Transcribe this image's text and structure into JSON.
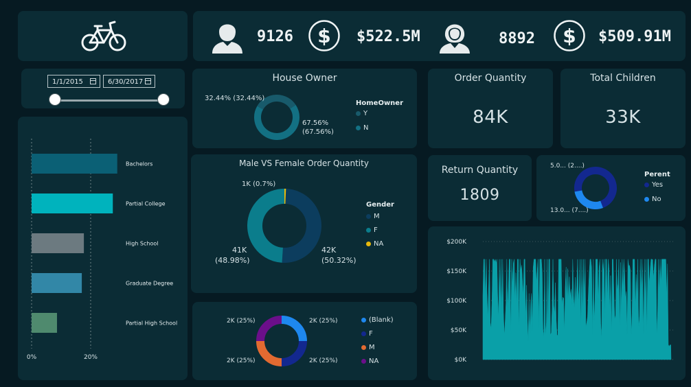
{
  "kpis": {
    "male_count": "9126",
    "male_revenue": "$522.5M",
    "female_count": "8892",
    "female_revenue": "$509.91M"
  },
  "date_filter": {
    "start": "1/1/2015",
    "end": "6/30/2017",
    "range_fraction": [
      0,
      1
    ]
  },
  "education_chart": {
    "type": "bar",
    "orientation": "horizontal",
    "categories": [
      "Bachelors",
      "Partial College",
      "High School",
      "Graduate Degree",
      "Partial High School"
    ],
    "values": [
      29,
      27.5,
      17.7,
      17,
      8.6
    ],
    "colors": [
      "#0b6075",
      "#00b3bd",
      "#6c7a80",
      "#3287a7",
      "#4f8a6e"
    ],
    "xlim": [
      0,
      30
    ],
    "x_ticks": [
      "0%",
      "20%"
    ],
    "x_tick_values": [
      0,
      20
    ],
    "grid": true
  },
  "house_owner": {
    "title": "House Owner",
    "legend_title": "HomeOwner",
    "chart_data": {
      "type": "pie",
      "categories": [
        "Y",
        "N"
      ],
      "values": [
        32.44,
        67.56
      ],
      "colors": [
        "#185a6b",
        "#137083"
      ]
    },
    "slice_labels": [
      "32.44% (32.44%)",
      "67.56%",
      "(67.56%)"
    ]
  },
  "order_quantity": {
    "title": "Order Quantity",
    "value": "84K"
  },
  "total_children": {
    "title": "Total Children",
    "value": "33K"
  },
  "gender_orders": {
    "title": "Male VS Female Order Quantity",
    "legend_title": "Gender",
    "chart_data": {
      "type": "pie",
      "categories": [
        "M",
        "F",
        "NA"
      ],
      "values": [
        50.32,
        48.98,
        0.7
      ],
      "colors": [
        "#0c3d5e",
        "#0b7d8c",
        "#e8b90c"
      ]
    },
    "labels": {
      "na": "1K (0.7%)",
      "f_a": "41K",
      "f_b": "(48.98%)",
      "m_a": "42K",
      "m_b": "(50.32%)"
    }
  },
  "return_quantity": {
    "title": "Return Quantity",
    "value": "1809"
  },
  "parent": {
    "legend_title": "Perent",
    "chart_data": {
      "type": "pie",
      "categories": [
        "Yes",
        "No"
      ],
      "values": [
        72,
        28
      ],
      "colors": [
        "#13288f",
        "#1e88ef"
      ]
    },
    "labels": [
      "5.0... (2....)",
      "13.0... (7....)"
    ]
  },
  "marital": {
    "chart_data": {
      "type": "pie",
      "categories": [
        "(Blank)",
        "F",
        "M",
        "NA"
      ],
      "values": [
        25,
        25,
        25,
        25
      ],
      "colors": [
        "#1e88ef",
        "#13288f",
        "#e26a31",
        "#6b0f8a"
      ]
    },
    "labels": [
      "2K (25%)",
      "2K (25%)",
      "2K (25%)",
      "2K (25%)"
    ]
  },
  "revenue_area": {
    "chart_data": {
      "type": "area",
      "ylim": [
        0,
        200000
      ],
      "y_ticks": [
        "$200K",
        "$150K",
        "$100K",
        "$50K",
        "$0K"
      ],
      "y_tick_values": [
        200000,
        150000,
        100000,
        50000,
        0
      ],
      "color": "#0aa0a8",
      "typical_range": [
        30000,
        170000
      ]
    }
  }
}
